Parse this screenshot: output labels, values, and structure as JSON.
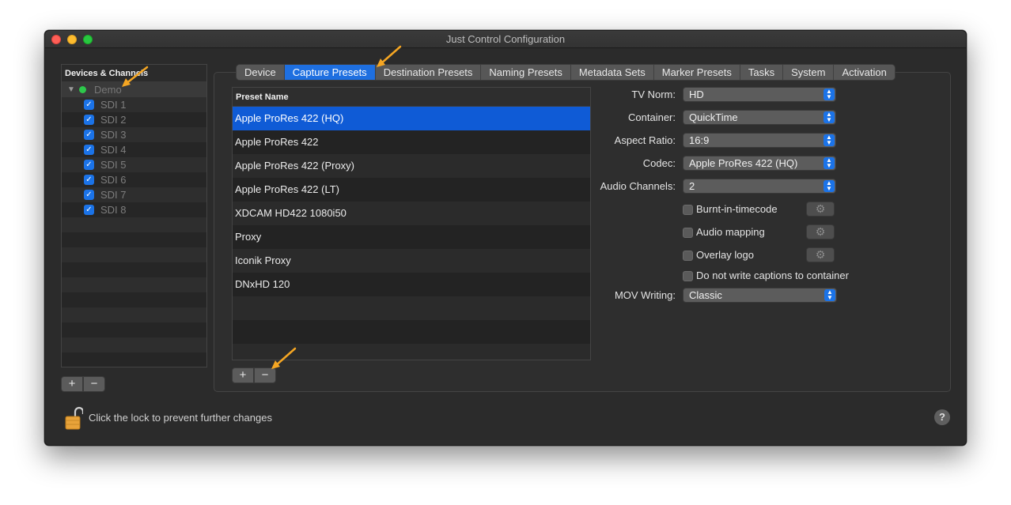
{
  "window": {
    "title": "Just Control Configuration"
  },
  "devices": {
    "header": "Devices & Channels",
    "group": {
      "label": "Demo",
      "expanded": true,
      "status_color": "#2dc84b"
    },
    "channels": [
      {
        "label": "SDI 1",
        "checked": true
      },
      {
        "label": "SDI 2",
        "checked": true
      },
      {
        "label": "SDI 3",
        "checked": true
      },
      {
        "label": "SDI 4",
        "checked": true
      },
      {
        "label": "SDI 5",
        "checked": true
      },
      {
        "label": "SDI 6",
        "checked": true
      },
      {
        "label": "SDI 7",
        "checked": true
      },
      {
        "label": "SDI 8",
        "checked": true
      }
    ],
    "add_label": "+",
    "remove_label": "−"
  },
  "tabs": [
    {
      "label": "Device",
      "active": false
    },
    {
      "label": "Capture Presets",
      "active": true
    },
    {
      "label": "Destination Presets",
      "active": false
    },
    {
      "label": "Naming Presets",
      "active": false
    },
    {
      "label": "Metadata Sets",
      "active": false
    },
    {
      "label": "Marker Presets",
      "active": false
    },
    {
      "label": "Tasks",
      "active": false
    },
    {
      "label": "System",
      "active": false
    },
    {
      "label": "Activation",
      "active": false
    }
  ],
  "presets": {
    "header": "Preset Name",
    "items": [
      "Apple ProRes 422 (HQ)",
      "Apple ProRes 422",
      "Apple ProRes 422 (Proxy)",
      "Apple ProRes 422 (LT)",
      "XDCAM HD422 1080i50",
      "Proxy",
      "Iconik Proxy",
      "DNxHD 120"
    ],
    "selected_index": 0,
    "add_label": "+",
    "remove_label": "−"
  },
  "form": {
    "tv_norm": {
      "label": "TV Norm:",
      "value": "HD"
    },
    "container": {
      "label": "Container:",
      "value": "QuickTime"
    },
    "aspect_ratio": {
      "label": "Aspect Ratio:",
      "value": "16:9"
    },
    "codec": {
      "label": "Codec:",
      "value": "Apple ProRes 422 (HQ)"
    },
    "audio_channels": {
      "label": "Audio Channels:",
      "value": "2"
    },
    "burnt_in_timecode": {
      "label": "Burnt-in-timecode",
      "checked": false
    },
    "audio_mapping": {
      "label": "Audio mapping",
      "checked": false
    },
    "overlay_logo": {
      "label": "Overlay logo",
      "checked": false
    },
    "no_captions": {
      "label": "Do not write captions to container",
      "checked": false
    },
    "mov_writing": {
      "label": "MOV Writing:",
      "value": "Classic"
    }
  },
  "footer": {
    "lock_text": "Click the lock to prevent further changes",
    "help_label": "?"
  },
  "colors": {
    "accent": "#1e6fe0",
    "selection": "#0f5bd6",
    "annotation_arrow": "#f5a623",
    "window_bg": "#2b2b2b"
  },
  "icons": {
    "lock": "unlocked-padlock-icon",
    "gear": "gear-icon",
    "help": "question-mark-icon"
  }
}
